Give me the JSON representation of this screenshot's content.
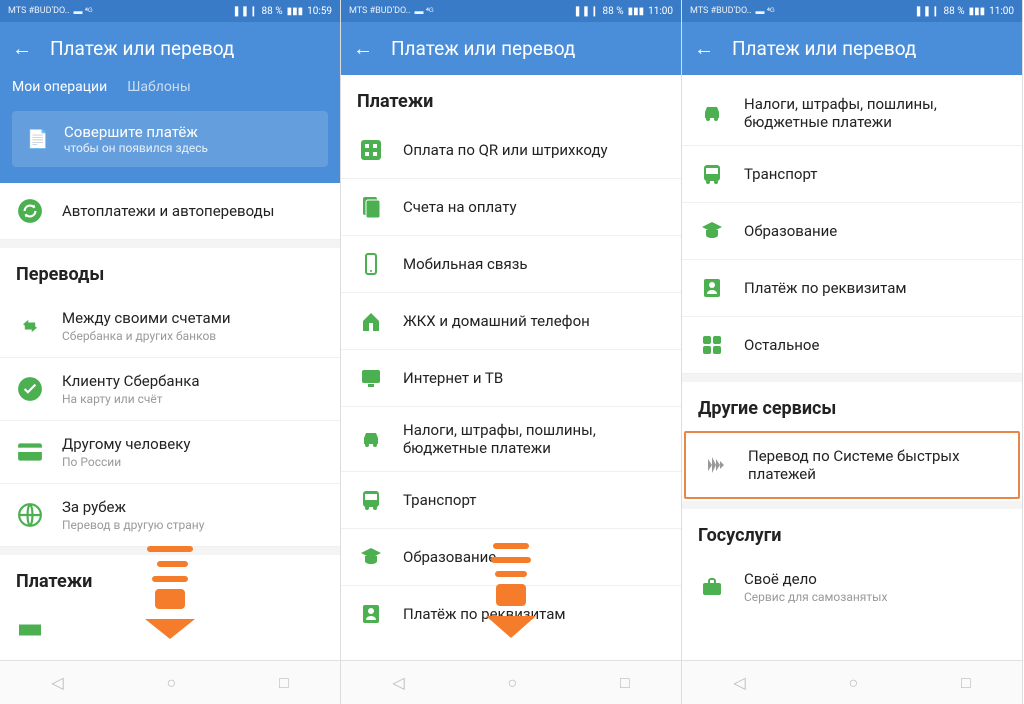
{
  "status": {
    "carrier": "MTS #BUD'DO..",
    "signal": "▬ ⁴ᴳ",
    "vibrate": "❚❚❙",
    "battery": "88 %",
    "time1": "10:59",
    "time2": "11:00"
  },
  "header": {
    "title": "Платеж или перевод"
  },
  "tabs": {
    "mine": "Мои операции",
    "templates": "Шаблоны"
  },
  "banner": {
    "title": "Совершите платёж",
    "sub": "чтобы он появился здесь"
  },
  "screen1": {
    "autopay": "Автоплатежи и автопереводы",
    "transfers_title": "Переводы",
    "t1": "Между своими счетами",
    "t1s": "Сбербанка и других банков",
    "t2": "Клиенту Сбербанка",
    "t2s": "На карту или счёт",
    "t3": "Другому человеку",
    "t3s": "По России",
    "t4": "За рубеж",
    "t4s": "Перевод в другую страну",
    "payments_title": "Платежи"
  },
  "screen2": {
    "payments_title": "Платежи",
    "p1": "Оплата по QR или штрихкоду",
    "p2": "Счета на оплату",
    "p3": "Мобильная связь",
    "p4": "ЖКХ и домашний телефон",
    "p5": "Интернет и ТВ",
    "p6": "Налоги, штрафы, пошлины, бюджетные платежи",
    "p7": "Транспорт",
    "p8": "Образование",
    "p9": "Платёж по реквизитам"
  },
  "screen3": {
    "p6": "Налоги, штрафы, пошлины, бюджетные платежи",
    "p7": "Транспорт",
    "p8": "Образование",
    "p9": "Платёж по реквизитам",
    "p10": "Остальное",
    "other_title": "Другие сервисы",
    "sbp": "Перевод по Системе быстрых платежей",
    "gos_title": "Госуслуги",
    "g1": "Своё дело",
    "g1s": "Сервис для самозанятых"
  }
}
